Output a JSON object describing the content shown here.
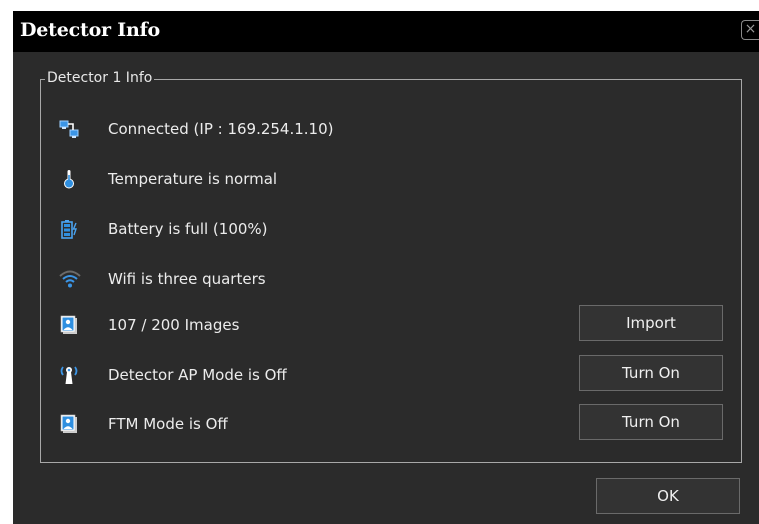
{
  "dialog": {
    "title": "Detector Info",
    "close_label": "×",
    "ok_label": "OK"
  },
  "group": {
    "title": "Detector 1 Info"
  },
  "rows": [
    {
      "icon": "network-connected-icon",
      "label": "Connected (IP : 169.254.1.10)"
    },
    {
      "icon": "thermometer-icon",
      "label": "Temperature is normal"
    },
    {
      "icon": "battery-full-icon",
      "label": "Battery is full (100%)"
    },
    {
      "icon": "wifi-icon",
      "label": "Wifi is three quarters"
    },
    {
      "icon": "images-icon",
      "label": "107 / 200 Images",
      "button": "Import"
    },
    {
      "icon": "antenna-icon",
      "label": "Detector AP Mode is Off",
      "button": "Turn On"
    },
    {
      "icon": "ftm-image-icon",
      "label": "FTM Mode is Off",
      "button": "Turn On"
    }
  ],
  "colors": {
    "background": "#2b2b2b",
    "titlebar": "#000000",
    "icon_blue": "#2f8fe0"
  }
}
